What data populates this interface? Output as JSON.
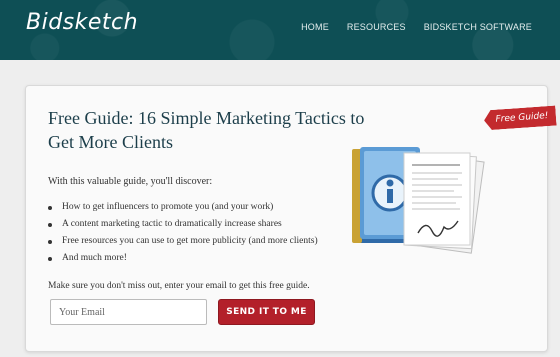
{
  "header": {
    "logo": "Bidsketch",
    "nav": [
      "HOME",
      "RESOURCES",
      "BIDSKETCH SOFTWARE"
    ]
  },
  "card": {
    "title": "Free Guide: 16 Simple Marketing Tactics to Get More Clients",
    "ribbon": "Free Guide!",
    "intro": "With this valuable guide, you'll discover:",
    "bullets": [
      "How to get influencers to promote you (and your work)",
      "A content marketing tactic to dramatically increase shares",
      "Free resources you can use to get more publicity (and more clients)",
      "And much more!"
    ],
    "cta": "Make sure you don't miss out, enter your email to get this free guide.",
    "email_placeholder": "Your Email",
    "submit_label": "SEND IT TO ME"
  },
  "colors": {
    "header_bg": "#0e4f55",
    "button_red": "#b3202a",
    "ribbon_red": "#c32a2e",
    "title_color": "#1c3e4a"
  },
  "icons": [
    "guide-book-illustration",
    "signed-documents-illustration"
  ]
}
